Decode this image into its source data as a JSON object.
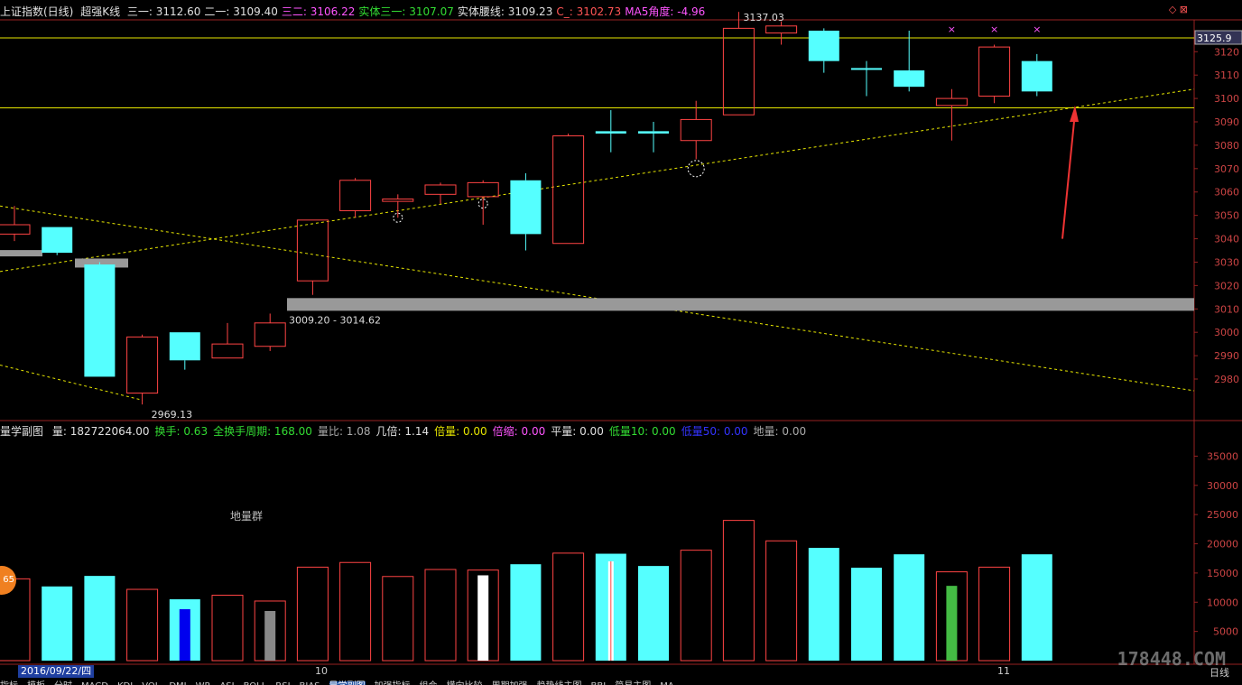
{
  "header": {
    "title": "上证指数(日线)",
    "indicator": "超强K线",
    "items": [
      {
        "label": "三一: 3112.60",
        "color": "white"
      },
      {
        "label": "二一: 3109.40",
        "color": "white"
      },
      {
        "label": "三二: 3106.22",
        "color": "mag"
      },
      {
        "label": "实体三一: 3107.07",
        "color": "green"
      },
      {
        "label": "实体腰线: 3109.23",
        "color": "white"
      },
      {
        "label": "C_: 3102.73",
        "color": "red"
      },
      {
        "label": "MA5角度: -4.96",
        "color": "mag"
      }
    ],
    "controls": "◇ ⊠"
  },
  "volume_header": {
    "name": "量学副图",
    "items": [
      {
        "label": "量: 182722064.00",
        "color": "white"
      },
      {
        "label": "换手: 0.63",
        "color": "green"
      },
      {
        "label": "全换手周期: 168.00",
        "color": "green"
      },
      {
        "label": "量比: 1.08",
        "color": "gray"
      },
      {
        "label": "几倍: 1.14",
        "color": "white"
      },
      {
        "label": "倍量: 0.00",
        "color": "yellow"
      },
      {
        "label": "倍缩: 0.00",
        "color": "mag"
      },
      {
        "label": "平量: 0.00",
        "color": "white"
      },
      {
        "label": "低量10: 0.00",
        "color": "green"
      },
      {
        "label": "低量50: 0.00",
        "color": "blue"
      },
      {
        "label": "地量: 0.00",
        "color": "gray"
      }
    ],
    "note": "地量群"
  },
  "chart_data": [
    {
      "type": "candlestick",
      "title": "上证指数(日线)",
      "ylim": [
        2960,
        3140
      ],
      "yticks": [
        2980,
        2990,
        3000,
        3010,
        3020,
        3030,
        3040,
        3050,
        3060,
        3070,
        3080,
        3090,
        3100,
        3110,
        3120
      ],
      "current_price_label": "3125.9",
      "annotations": {
        "high": "3137.03",
        "low": "2969.13",
        "zone": "3009.20 - 3014.62"
      },
      "candles": [
        {
          "open": 3046,
          "close": 3042,
          "high": 3054,
          "low": 3039,
          "color": "red"
        },
        {
          "open": 3045,
          "close": 3034,
          "high": 3045,
          "low": 3033,
          "color": "cyan"
        },
        {
          "open": 3029,
          "close": 2981,
          "high": 3030,
          "low": 2981,
          "color": "cyan"
        },
        {
          "open": 2974,
          "close": 2998,
          "high": 2999,
          "low": 2969.13,
          "color": "red"
        },
        {
          "open": 3000,
          "close": 2988,
          "high": 3000,
          "low": 2984,
          "color": "cyan"
        },
        {
          "open": 2989,
          "close": 2995,
          "high": 3004,
          "low": 2989,
          "color": "red"
        },
        {
          "open": 2994,
          "close": 3004,
          "high": 3008,
          "low": 2992,
          "color": "red"
        },
        {
          "open": 3022,
          "close": 3048,
          "high": 3048,
          "low": 3016,
          "color": "red"
        },
        {
          "open": 3052,
          "close": 3065,
          "high": 3066,
          "low": 3049,
          "color": "red"
        },
        {
          "open": 3056,
          "close": 3057,
          "high": 3059,
          "low": 3049,
          "color": "red"
        },
        {
          "open": 3059,
          "close": 3063,
          "high": 3064,
          "low": 3055,
          "color": "red"
        },
        {
          "open": 3058,
          "close": 3064,
          "high": 3065,
          "low": 3046,
          "color": "red"
        },
        {
          "open": 3065,
          "close": 3042,
          "high": 3068,
          "low": 3035,
          "color": "cyan"
        },
        {
          "open": 3038,
          "close": 3084,
          "high": 3085,
          "low": 3038,
          "color": "red"
        },
        {
          "open": 3086,
          "close": 3085,
          "high": 3095,
          "low": 3077,
          "color": "cyan"
        },
        {
          "open": 3086,
          "close": 3085,
          "high": 3090,
          "low": 3077,
          "color": "cyan"
        },
        {
          "open": 3082,
          "close": 3091,
          "high": 3099,
          "low": 3074,
          "color": "red"
        },
        {
          "open": 3093,
          "close": 3130,
          "high": 3137.03,
          "low": 3093,
          "color": "red"
        },
        {
          "open": 3128,
          "close": 3131,
          "high": 3133,
          "low": 3123,
          "color": "red"
        },
        {
          "open": 3129,
          "close": 3116,
          "high": 3130,
          "low": 3111,
          "color": "cyan"
        },
        {
          "open": 3113,
          "close": 3113,
          "high": 3116,
          "low": 3101,
          "color": "cyan"
        },
        {
          "open": 3112,
          "close": 3105,
          "high": 3129,
          "low": 3103,
          "color": "cyan"
        },
        {
          "open": 3097,
          "close": 3100,
          "high": 3104,
          "low": 3082,
          "color": "red"
        },
        {
          "open": 3101,
          "close": 3122,
          "high": 3123,
          "low": 3098,
          "color": "red"
        },
        {
          "open": 3116,
          "close": 3103,
          "high": 3119,
          "low": 3101,
          "color": "cyan"
        }
      ]
    },
    {
      "type": "bar",
      "title": "量学副图",
      "ylim": [
        0,
        39000
      ],
      "yticks": [
        5000,
        10000,
        15000,
        20000,
        25000,
        30000,
        35000
      ],
      "values": [
        14000,
        12700,
        14500,
        12200,
        10500,
        11200,
        10200,
        16000,
        16800,
        14400,
        15600,
        15500,
        16500,
        18400,
        18300,
        16200,
        18900,
        24000,
        20500,
        19300,
        15900,
        18200,
        15200,
        16000,
        18200
      ],
      "fill": [
        "hollow-red",
        "cyan",
        "cyan",
        "hollow-red",
        "cyan",
        "hollow-red",
        "hollow-red",
        "hollow-red",
        "hollow-red",
        "hollow-red",
        "hollow-red",
        "hollow-red",
        "cyan",
        "hollow-red",
        "cyan",
        "cyan",
        "hollow-red",
        "hollow-red",
        "hollow-red",
        "cyan",
        "cyan",
        "cyan",
        "hollow-red",
        "hollow-red",
        "cyan"
      ],
      "inner_marks": [
        {
          "index": 4,
          "value": 8800,
          "color": "#0000ee"
        },
        {
          "index": 6,
          "value": 8500,
          "color": "#888888"
        },
        {
          "index": 11,
          "value": 14600,
          "color": "#ffffff"
        },
        {
          "index": 14,
          "value": 17000,
          "color": "#ffffff"
        },
        {
          "index": 22,
          "value": 12800,
          "color": "#44bb44"
        }
      ],
      "date_label": "2016/09/22/四",
      "months": [
        "10",
        "11"
      ],
      "period": "日线",
      "badge": "65"
    }
  ],
  "tabs": [
    "指标",
    "模板",
    "分时",
    "MACD",
    "KDJ",
    "VOL",
    "DMI",
    "WR",
    "ASI",
    "BOLL",
    "RSI",
    "BIAS",
    "量学副图",
    "加强指标",
    "组合",
    "横向比较",
    "周期加强",
    "趋势线主图",
    "BBI",
    "简易主图",
    "MA"
  ],
  "active_tab": "量学副图",
  "watermark": "178448.COM"
}
